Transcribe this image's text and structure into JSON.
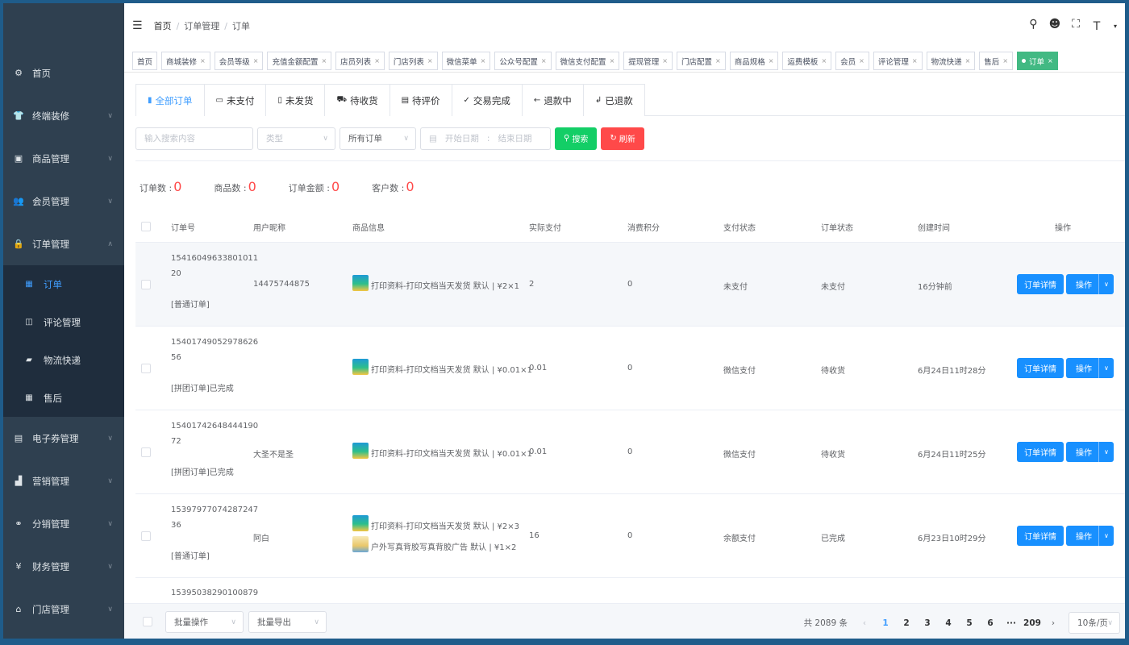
{
  "sidebar": {
    "items": [
      {
        "label": "首页",
        "icon": "dashboard-icon",
        "glyph": "⚙",
        "has_children": false
      },
      {
        "label": "终端装修",
        "icon": "shirt-icon",
        "glyph": "👕",
        "has_children": true
      },
      {
        "label": "商品管理",
        "icon": "goods-icon",
        "glyph": "▣",
        "has_children": true
      },
      {
        "label": "会员管理",
        "icon": "members-icon",
        "glyph": "👥",
        "has_children": true
      },
      {
        "label": "订单管理",
        "icon": "lock-icon",
        "glyph": "🔒",
        "has_children": true,
        "expanded": true
      },
      {
        "label": "电子券管理",
        "icon": "coupon-icon",
        "glyph": "▤",
        "has_children": true
      },
      {
        "label": "营销管理",
        "icon": "marketing-icon",
        "glyph": "▟",
        "has_children": true
      },
      {
        "label": "分销管理",
        "icon": "distribution-icon",
        "glyph": "⚭",
        "has_children": true
      },
      {
        "label": "财务管理",
        "icon": "finance-icon",
        "glyph": "¥",
        "has_children": true
      },
      {
        "label": "门店管理",
        "icon": "store-icon",
        "glyph": "⌂",
        "has_children": true
      }
    ],
    "sub_items": [
      {
        "label": "订单",
        "icon": "order-doc-icon",
        "glyph": "▦",
        "active": true
      },
      {
        "label": "评论管理",
        "icon": "comment-icon",
        "glyph": "◫",
        "active": false
      },
      {
        "label": "物流快递",
        "icon": "truck-icon",
        "glyph": "▰",
        "active": false
      },
      {
        "label": "售后",
        "icon": "aftersale-icon",
        "glyph": "▦",
        "active": false
      }
    ]
  },
  "topbar": {
    "breadcrumb": [
      "首页",
      "订单管理",
      "订单"
    ]
  },
  "tags": [
    {
      "label": "首页",
      "closable": false
    },
    {
      "label": "商城装修",
      "closable": true
    },
    {
      "label": "会员等级",
      "closable": true
    },
    {
      "label": "充值金额配置",
      "closable": true
    },
    {
      "label": "店员列表",
      "closable": true
    },
    {
      "label": "门店列表",
      "closable": true
    },
    {
      "label": "微信菜单",
      "closable": true
    },
    {
      "label": "公众号配置",
      "closable": true
    },
    {
      "label": "微信支付配置",
      "closable": true
    },
    {
      "label": "提现管理",
      "closable": true
    },
    {
      "label": "门店配置",
      "closable": true
    },
    {
      "label": "商品规格",
      "closable": true
    },
    {
      "label": "运费模板",
      "closable": true
    },
    {
      "label": "会员",
      "closable": true
    },
    {
      "label": "评论管理",
      "closable": true
    },
    {
      "label": "物流快递",
      "closable": true
    },
    {
      "label": "售后",
      "closable": true
    },
    {
      "label": "订单",
      "closable": true,
      "active": true
    }
  ],
  "tabs": [
    {
      "label": "全部订单",
      "glyph": "▮",
      "active": true
    },
    {
      "label": "未支付",
      "glyph": "▭"
    },
    {
      "label": "未发货",
      "glyph": "▯"
    },
    {
      "label": "待收货",
      "glyph": "⛟"
    },
    {
      "label": "待评价",
      "glyph": "▤"
    },
    {
      "label": "交易完成",
      "glyph": "✓"
    },
    {
      "label": "退款中",
      "glyph": "←"
    },
    {
      "label": "已退款",
      "glyph": "↲"
    }
  ],
  "filters": {
    "search_placeholder": "输入搜索内容",
    "type_placeholder": "类型",
    "order_select": "所有订单",
    "start_date": "开始日期",
    "date_sep": ":",
    "end_date": "结束日期",
    "search_button": "搜索",
    "refresh_button": "刷新"
  },
  "stats": [
    {
      "label": "订单数 :",
      "value": "0"
    },
    {
      "label": "商品数 :",
      "value": "0"
    },
    {
      "label": "订单金额 :",
      "value": "0"
    },
    {
      "label": "客户数 :",
      "value": "0"
    }
  ],
  "table": {
    "columns": [
      "订单号",
      "用户昵称",
      "商品信息",
      "实际支付",
      "消费积分",
      "支付状态",
      "订单状态",
      "创建时间",
      "操作"
    ],
    "rows": [
      {
        "order_no_1": "15416049633801011",
        "order_no_2": "20",
        "order_type": "[普通订单]",
        "nickname": "14475744875",
        "products": [
          {
            "name": "打印资料-打印文档当天发货 默认 | ¥2×1",
            "thumb": "thumb"
          }
        ],
        "paid": "2",
        "points": "0",
        "pay_status": "未支付",
        "order_status": "未支付",
        "created": "16分钟前"
      },
      {
        "order_no_1": "15401749052978626",
        "order_no_2": "56",
        "order_type": "[拼团订单]已完成",
        "nickname": "",
        "products": [
          {
            "name": "打印资料-打印文档当天发货 默认 | ¥0.01×1",
            "thumb": "thumb"
          }
        ],
        "paid": "0.01",
        "points": "0",
        "pay_status": "微信支付",
        "order_status": "待收货",
        "created": "6月24日11时28分"
      },
      {
        "order_no_1": "15401742648444190",
        "order_no_2": "72",
        "order_type": "[拼团订单]已完成",
        "nickname": "大圣不是圣",
        "products": [
          {
            "name": "打印资料-打印文档当天发货 默认 | ¥0.01×1",
            "thumb": "thumb"
          }
        ],
        "paid": "0.01",
        "points": "0",
        "pay_status": "微信支付",
        "order_status": "待收货",
        "created": "6月24日11时25分"
      },
      {
        "order_no_1": "15397977074287247",
        "order_no_2": "36",
        "order_type": "[普通订单]",
        "nickname": "阿白",
        "products": [
          {
            "name": "打印资料-打印文档当天发货 默认 | ¥2×3",
            "thumb": "thumb"
          },
          {
            "name": "户外写真背胶写真背胶广告 默认 | ¥1×2",
            "thumb": "thumb2"
          }
        ],
        "paid": "16",
        "points": "0",
        "pay_status": "余额支付",
        "order_status": "已完成",
        "created": "6月23日10时29分"
      }
    ],
    "partial_row_order_no": "15395038290100879",
    "detail_button": "订单详情",
    "action_button": "操作"
  },
  "footer": {
    "batch_action": "批量操作",
    "batch_export": "批量导出",
    "total": "共 2089 条",
    "pages": [
      "1",
      "2",
      "3",
      "4",
      "5",
      "6"
    ],
    "ellipsis": "···",
    "last_page": "209",
    "page_size": "10条/页"
  }
}
